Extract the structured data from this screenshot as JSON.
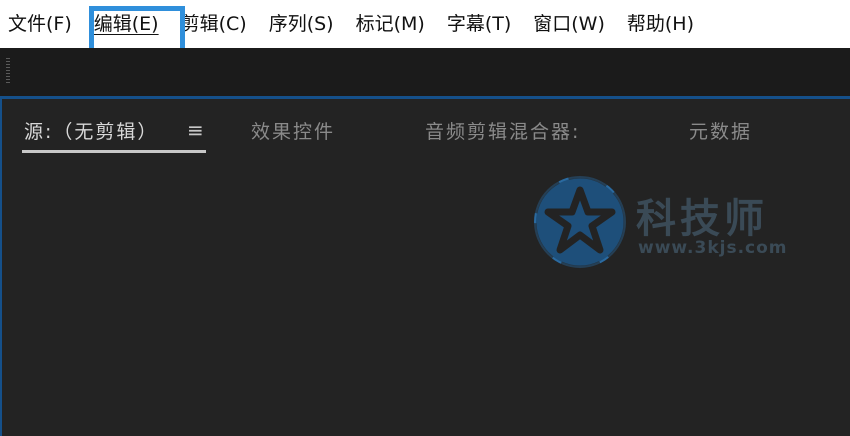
{
  "menubar": {
    "items": [
      {
        "label": "文件(F)"
      },
      {
        "label": "编辑(E)"
      },
      {
        "label": "剪辑(C)"
      },
      {
        "label": "序列(S)"
      },
      {
        "label": "标记(M)"
      },
      {
        "label": "字幕(T)"
      },
      {
        "label": "窗口(W)"
      },
      {
        "label": "帮助(H)"
      }
    ],
    "highlighted_index": 1,
    "highlight_color": "#2f8fdb"
  },
  "panel": {
    "tabs": [
      {
        "label": "源:（无剪辑）",
        "active": true
      },
      {
        "label": "效果控件",
        "active": false
      },
      {
        "label": "音频剪辑混合器:",
        "active": false
      },
      {
        "label": "元数据",
        "active": false
      }
    ],
    "menu_icon": "hamburger-icon",
    "accent_color": "#15508a"
  },
  "watermark": {
    "brand": "科技师",
    "url": "www.3kjs.com",
    "logo_icon": "star-in-circle-icon",
    "color": "#3a4a56"
  }
}
